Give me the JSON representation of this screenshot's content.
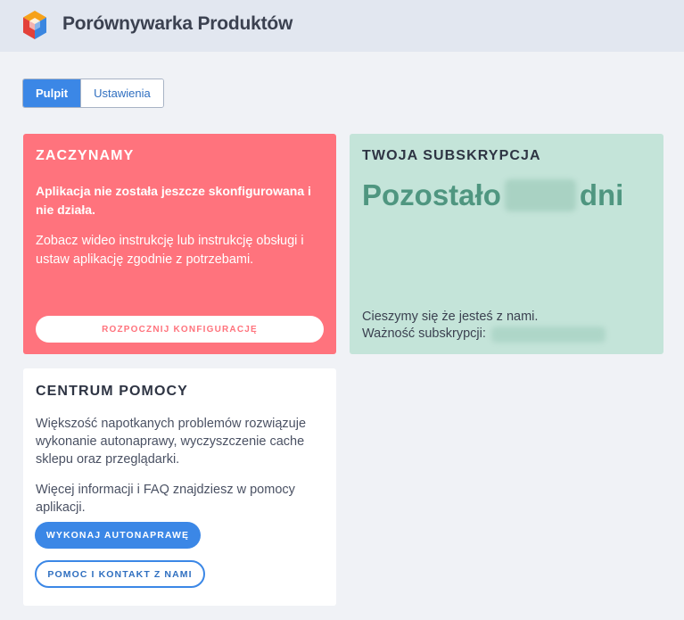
{
  "header": {
    "title": "Porównywarka Produktów",
    "logo_icon": "cube-logo-icon"
  },
  "tabs": [
    {
      "label": "Pulpit",
      "active": true
    },
    {
      "label": "Ustawienia",
      "active": false
    }
  ],
  "start_card": {
    "title": "ZACZYNAMY",
    "warning": "Aplikacja nie została jeszcze skonfigurowana i nie działa.",
    "description": "Zobacz wideo instrukcję lub instrukcję obsługi i ustaw aplikację zgodnie z potrzebami.",
    "button_label": "ROZPOCZNIJ KONFIGURACJĘ",
    "color": "#ff737d"
  },
  "subscription_card": {
    "title": "TWOJA SUBSKRYPCJA",
    "remaining_prefix": "Pozostało",
    "remaining_suffix": "dni",
    "message": "Cieszymy się że jesteś z nami.",
    "validity_label": "Ważność subskrypcji:",
    "color": "#c4e4d9"
  },
  "help_card": {
    "title": "CENTRUM POMOCY",
    "paragraph1": "Większość napotkanych problemów rozwiązuje wykonanie autonaprawy, wyczyszczenie cache sklepu oraz przeglądarki.",
    "paragraph2": "Więcej informacji i FAQ znajdziesz w pomocy aplikacji.",
    "repair_button": "WYKONAJ AUTONAPRAWĘ",
    "contact_button": "POMOC I KONTAKT Z NAMI"
  },
  "colors": {
    "accent": "#3b87e6",
    "background": "#f0f2f6",
    "header": "#e2e7f0"
  }
}
